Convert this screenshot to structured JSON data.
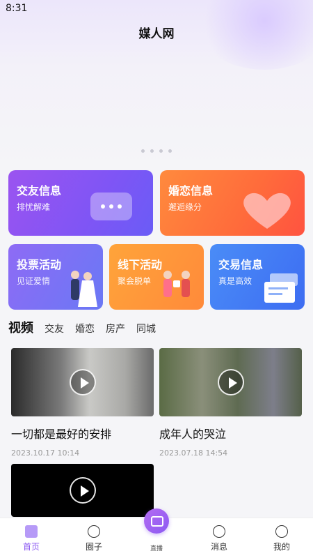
{
  "status": {
    "time": "8:31"
  },
  "header": {
    "title": "媒人网"
  },
  "cards": {
    "friend": {
      "title": "交友信息",
      "subtitle": "排忧解难"
    },
    "marriage": {
      "title": "婚恋信息",
      "subtitle": "邂逅缘分"
    },
    "vote": {
      "title": "投票活动",
      "subtitle": "见证爱情"
    },
    "offline": {
      "title": "线下活动",
      "subtitle": "聚会脱单"
    },
    "trade": {
      "title": "交易信息",
      "subtitle": "真是高效"
    }
  },
  "video_section": {
    "title": "视频",
    "tabs": [
      "交友",
      "婚恋",
      "房产",
      "同城"
    ]
  },
  "videos": [
    {
      "title": "一切都是最好的安排",
      "date": "2023.10.17 10:14"
    },
    {
      "title": "成年人的哭泣",
      "date": "2023.07.18 14:54"
    },
    {
      "title": "",
      "date": ""
    }
  ],
  "tabbar": {
    "home": "首页",
    "circle": "圈子",
    "live": "直播",
    "messages": "消息",
    "mine": "我的"
  },
  "colors": {
    "accent": "#8c5af2"
  }
}
